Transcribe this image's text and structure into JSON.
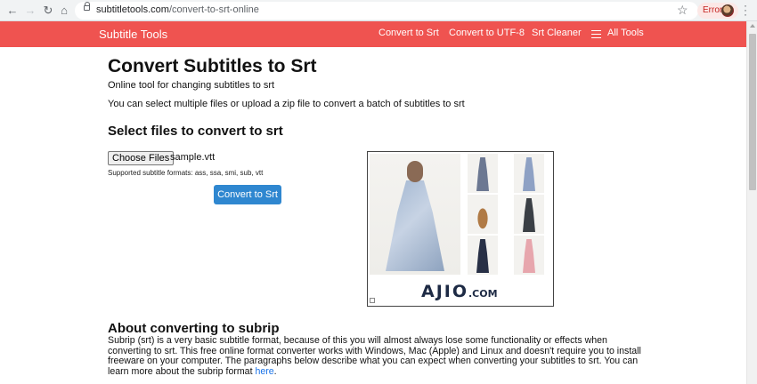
{
  "browser": {
    "url_host": "subtitletools.com",
    "url_path": "/convert-to-srt-online",
    "error_label": "Error"
  },
  "header": {
    "brand": "Subtitle Tools",
    "nav": [
      "Convert to Srt",
      "Convert to UTF-8",
      "Srt Cleaner",
      "All Tools"
    ]
  },
  "main": {
    "title": "Convert Subtitles to Srt",
    "subtitle": "Online tool for changing subtitles to srt",
    "description": "You can select multiple files or upload a zip file to convert a batch of subtitles to srt",
    "section_title": "Select files to convert to srt",
    "choose_files_label": "Choose Files",
    "file_name": "sample.vtt",
    "formats_text": "Supported subtitle formats: ass, ssa, smi, sub, vtt",
    "convert_button": "Convert to Srt"
  },
  "ad": {
    "logo": "AJIO",
    "logo_suffix": ".COM"
  },
  "about": {
    "title": "About converting to subrip",
    "text": "Subrip (srt) is a very basic subtitle format, because of this you will almost always lose some functionality or effects when converting to srt. This free online format converter works with Windows, Mac (Apple) and Linux and doesn't require you to install freeware on your computer. The paragraphs below describe what you can expect when converting your subtitles to srt. You can learn more about the subrip format ",
    "link_text": "here",
    "tail": "."
  },
  "colors": {
    "header_bg": "#ef5350",
    "button_bg": "#2f87d0"
  },
  "icons": [
    "back-arrow-icon",
    "forward-arrow-icon",
    "reload-icon",
    "home-icon",
    "lock-icon",
    "star-icon",
    "hamburger-icon",
    "more-vert-icon"
  ]
}
